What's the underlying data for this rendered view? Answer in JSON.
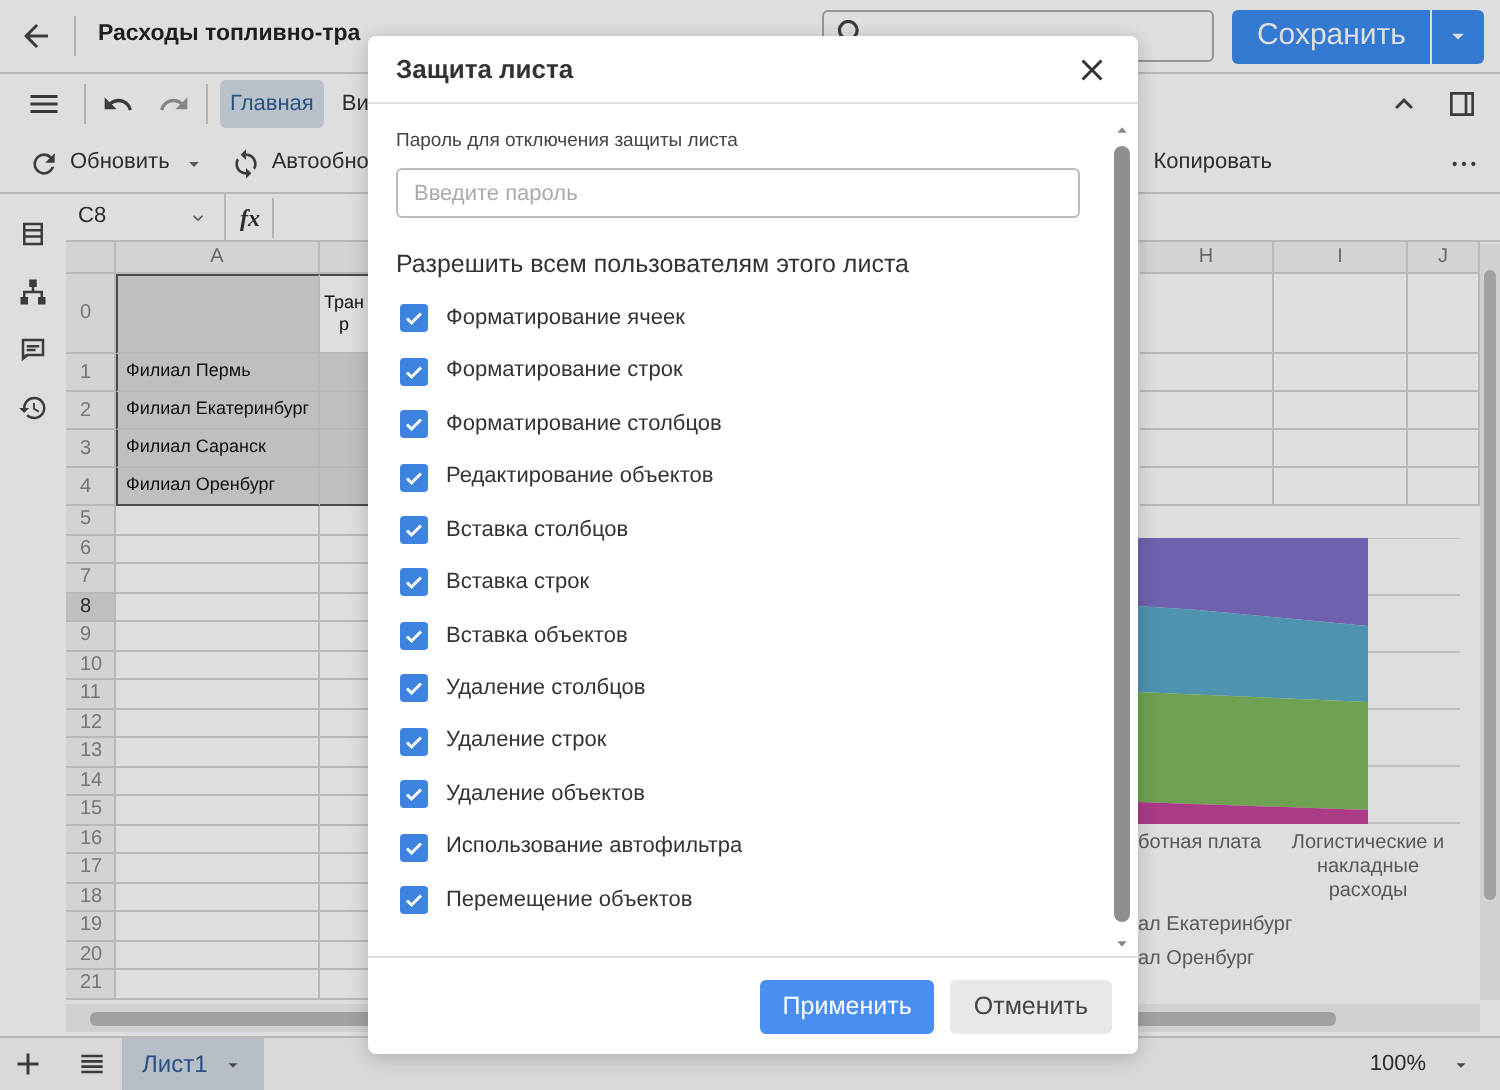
{
  "header": {
    "title": "Расходы топливно-тра",
    "save_label": "Сохранить"
  },
  "toolbar": {
    "tabs": [
      {
        "label": "Главная",
        "selected": true
      },
      {
        "label": "Ви",
        "selected": false
      }
    ],
    "commands": [
      {
        "label": "Обновить",
        "kind": "refresh"
      },
      {
        "label": "Автообно",
        "kind": "sync"
      },
      {
        "label": "Копировать",
        "kind": "copy"
      }
    ]
  },
  "formula_bar": {
    "cell_name": "C8",
    "function_label": "fx"
  },
  "sheet": {
    "columns": [
      "A",
      "H",
      "I",
      "J"
    ],
    "rows": [
      {
        "label": "0",
        "selected": false,
        "column_2": "Тран\nр"
      },
      {
        "label": "1",
        "selected": false,
        "branch": "Филиал Пермь"
      },
      {
        "label": "2",
        "selected": false,
        "branch": "Филиал Екатеринбург"
      },
      {
        "label": "3",
        "selected": false,
        "branch": "Филиал Саранск"
      },
      {
        "label": "4",
        "selected": false,
        "branch": "Филиал Оренбург"
      },
      {
        "label": "5",
        "selected": false
      },
      {
        "label": "6",
        "selected": false
      },
      {
        "label": "7",
        "selected": false
      },
      {
        "label": "8",
        "selected": true
      },
      {
        "label": "9",
        "selected": false
      },
      {
        "label": "10",
        "selected": false
      },
      {
        "label": "11",
        "selected": false
      },
      {
        "label": "12",
        "selected": false
      },
      {
        "label": "13",
        "selected": false
      },
      {
        "label": "14",
        "selected": false
      },
      {
        "label": "15",
        "selected": false
      },
      {
        "label": "16",
        "selected": false
      },
      {
        "label": "17",
        "selected": false
      },
      {
        "label": "18",
        "selected": false
      },
      {
        "label": "19",
        "selected": false
      },
      {
        "label": "20",
        "selected": false
      },
      {
        "label": "21",
        "selected": false
      }
    ]
  },
  "chart": {
    "category_labels": [
      "ботная плата",
      "Логистические и накладные расходы"
    ],
    "legend": [
      "ал Екатеринбург",
      "ал Оренбург"
    ]
  },
  "sheet_tabs": [
    {
      "label": "Лист1",
      "selected": true
    }
  ],
  "zoom": "100%",
  "dialog": {
    "title": "Защита листа",
    "password_label": "Пароль для отключения защиты листа",
    "password_placeholder": "Введите пароль",
    "permissions_heading": "Разрешить всем пользователям этого листа",
    "permissions": [
      {
        "label": "Форматирование ячеек",
        "checked": true
      },
      {
        "label": "Форматирование строк",
        "checked": true
      },
      {
        "label": "Форматирование столбцов",
        "checked": true
      },
      {
        "label": "Редактирование объектов",
        "checked": true
      },
      {
        "label": "Вставка столбцов",
        "checked": true
      },
      {
        "label": "Вставка строк",
        "checked": true
      },
      {
        "label": "Вставка объектов",
        "checked": true
      },
      {
        "label": "Удаление столбцов",
        "checked": true
      },
      {
        "label": "Удаление строк",
        "checked": true
      },
      {
        "label": "Удаление объектов",
        "checked": true
      },
      {
        "label": "Использование автофильтра",
        "checked": true
      },
      {
        "label": "Перемещение объектов",
        "checked": true
      }
    ],
    "apply_label": "Применить",
    "cancel_label": "Отменить"
  }
}
